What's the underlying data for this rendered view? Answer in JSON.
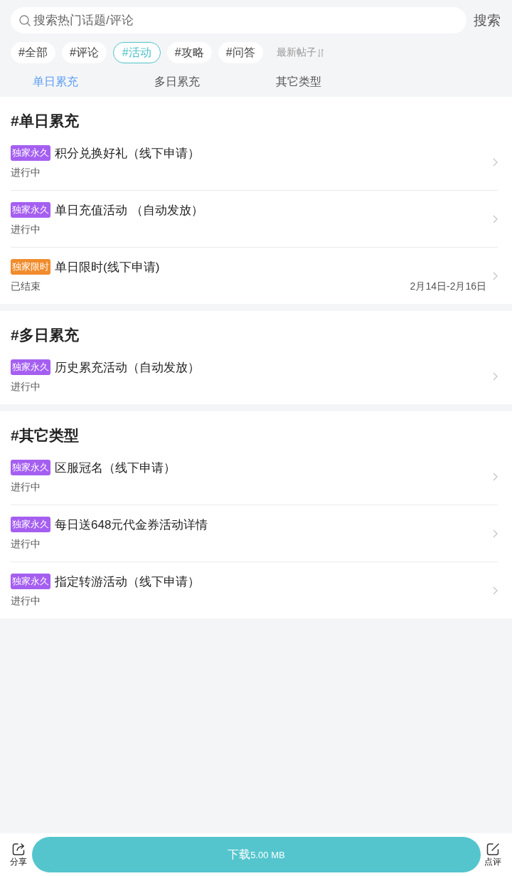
{
  "search": {
    "placeholder": "搜索热门话题/评论",
    "button": "搜索"
  },
  "filters": [
    {
      "label": "#全部",
      "selected": false
    },
    {
      "label": "#评论",
      "selected": false
    },
    {
      "label": "#活动",
      "selected": true
    },
    {
      "label": "#攻略",
      "selected": false
    },
    {
      "label": "#问答",
      "selected": false
    }
  ],
  "sort": {
    "label": "最新帖子"
  },
  "tabs": [
    {
      "label": "单日累充",
      "selected": true
    },
    {
      "label": "多日累充",
      "selected": false
    },
    {
      "label": "其它类型",
      "selected": false
    }
  ],
  "sections": [
    {
      "title": "#单日累充",
      "items": [
        {
          "tag": {
            "text": "独家永久",
            "color": "#a55ff0"
          },
          "title": "积分兑换好礼（线下申请）",
          "status": "进行中"
        },
        {
          "tag": {
            "text": "独家永久",
            "color": "#a55ff0"
          },
          "title": "单日充值活动 （自动发放）",
          "status": "进行中"
        },
        {
          "tag": {
            "text": "独家限时",
            "color": "#f08c2c"
          },
          "title": "单日限时(线下申请)",
          "status": "已结束",
          "date": "2月14日-2月16日"
        }
      ]
    },
    {
      "title": "#多日累充",
      "items": [
        {
          "tag": {
            "text": "独家永久",
            "color": "#a55ff0"
          },
          "title": "历史累充活动（自动发放）",
          "status": "进行中"
        }
      ]
    },
    {
      "title": "#其它类型",
      "items": [
        {
          "tag": {
            "text": "独家永久",
            "color": "#a55ff0"
          },
          "title": "区服冠名（线下申请）",
          "status": "进行中"
        },
        {
          "tag": {
            "text": "独家永久",
            "color": "#a55ff0"
          },
          "title": "每日送648元代金券活动详情",
          "status": "进行中"
        },
        {
          "tag": {
            "text": "独家永久",
            "color": "#a55ff0"
          },
          "title": "指定转游活动（线下申请）",
          "status": "进行中"
        }
      ]
    }
  ],
  "bottom_bar": {
    "share": "分享",
    "download": {
      "label": "下载",
      "size": "5.00 MB"
    },
    "review": "点评"
  }
}
